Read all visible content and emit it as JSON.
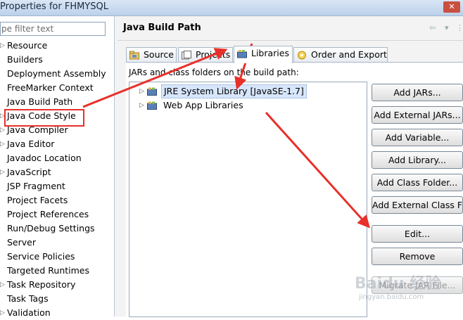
{
  "window": {
    "title": "Properties for FHMYSQL",
    "close_glyph": "✕"
  },
  "filter": {
    "text": "pe filter text"
  },
  "nav": {
    "items": [
      {
        "label": "Resource",
        "arrow": "▷"
      },
      {
        "label": "Builders",
        "arrow": ""
      },
      {
        "label": "Deployment Assembly",
        "arrow": ""
      },
      {
        "label": "FreeMarker Context",
        "arrow": ""
      },
      {
        "label": "Java Build Path",
        "arrow": "",
        "highlighted": true
      },
      {
        "label": "Java Code Style",
        "arrow": "▷"
      },
      {
        "label": "Java Compiler",
        "arrow": "▷"
      },
      {
        "label": "Java Editor",
        "arrow": "▷"
      },
      {
        "label": "Javadoc Location",
        "arrow": ""
      },
      {
        "label": "JavaScript",
        "arrow": "▷"
      },
      {
        "label": "JSP Fragment",
        "arrow": ""
      },
      {
        "label": "Project Facets",
        "arrow": ""
      },
      {
        "label": "Project References",
        "arrow": ""
      },
      {
        "label": "Run/Debug Settings",
        "arrow": ""
      },
      {
        "label": "Server",
        "arrow": ""
      },
      {
        "label": "Service Policies",
        "arrow": ""
      },
      {
        "label": "Targeted Runtimes",
        "arrow": ""
      },
      {
        "label": "Task Repository",
        "arrow": "▷"
      },
      {
        "label": "Task Tags",
        "arrow": ""
      },
      {
        "label": "Validation",
        "arrow": "▷"
      }
    ]
  },
  "page": {
    "title": "Java Build Path",
    "nav_back": "⇦",
    "nav_menu": "▾",
    "nav_more": "⋮",
    "tabs": [
      {
        "label": "Source",
        "icon": "source-folder-icon"
      },
      {
        "label": "Projects",
        "icon": "projects-icon"
      },
      {
        "label": "Libraries",
        "icon": "libraries-icon",
        "active": true
      },
      {
        "label": "Order and Export",
        "icon": "order-export-icon"
      }
    ],
    "panel_label": "JARs and class folders on the build path:",
    "tree": [
      {
        "label": "JRE System Library [JavaSE-1.7]",
        "twisty": "▷",
        "selected": true
      },
      {
        "label": "Web App Libraries",
        "twisty": "▷"
      }
    ],
    "buttons": [
      {
        "label": "Add JARs...",
        "enabled": true
      },
      {
        "label": "Add External JARs...",
        "enabled": true
      },
      {
        "label": "Add Variable...",
        "enabled": true
      },
      {
        "label": "Add Library...",
        "enabled": true
      },
      {
        "label": "Add Class Folder...",
        "enabled": true
      },
      {
        "label": "Add External Class Folder...",
        "enabled": true
      },
      {
        "label": "Edit...",
        "enabled": true
      },
      {
        "label": "Remove",
        "enabled": true
      },
      {
        "label": "Migrate JAR File...",
        "enabled": false
      }
    ]
  },
  "watermark": {
    "brand": "Baidu 经验",
    "url": "jingyan.baidu.com"
  },
  "colors": {
    "annotation_red": "#e8302a",
    "selection": "#d7e6fb"
  }
}
